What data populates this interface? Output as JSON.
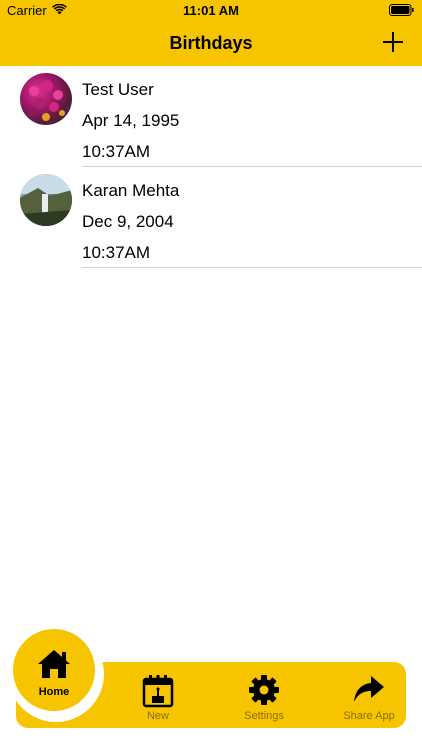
{
  "status_bar": {
    "carrier": "Carrier",
    "time": "11:01 AM"
  },
  "nav": {
    "title": "Birthdays",
    "add_icon": "plus-icon"
  },
  "birthdays": [
    {
      "name": "Test User",
      "date": "Apr 14, 1995",
      "time": "10:37AM",
      "avatar": "flowers-photo"
    },
    {
      "name": "Karan  Mehta",
      "date": "Dec 9, 2004",
      "time": "10:37AM",
      "avatar": "waterfall-photo"
    }
  ],
  "tabbar": {
    "tabs": [
      {
        "label": "Home",
        "icon": "home-icon",
        "selected": true
      },
      {
        "label": "New",
        "icon": "calendar-cake-icon"
      },
      {
        "label": "Settings",
        "icon": "gear-icon"
      },
      {
        "label": "Share App",
        "icon": "share-arrow-icon"
      }
    ]
  },
  "colors": {
    "accent": "#f7c500",
    "tab_label": "#8a6e00"
  }
}
